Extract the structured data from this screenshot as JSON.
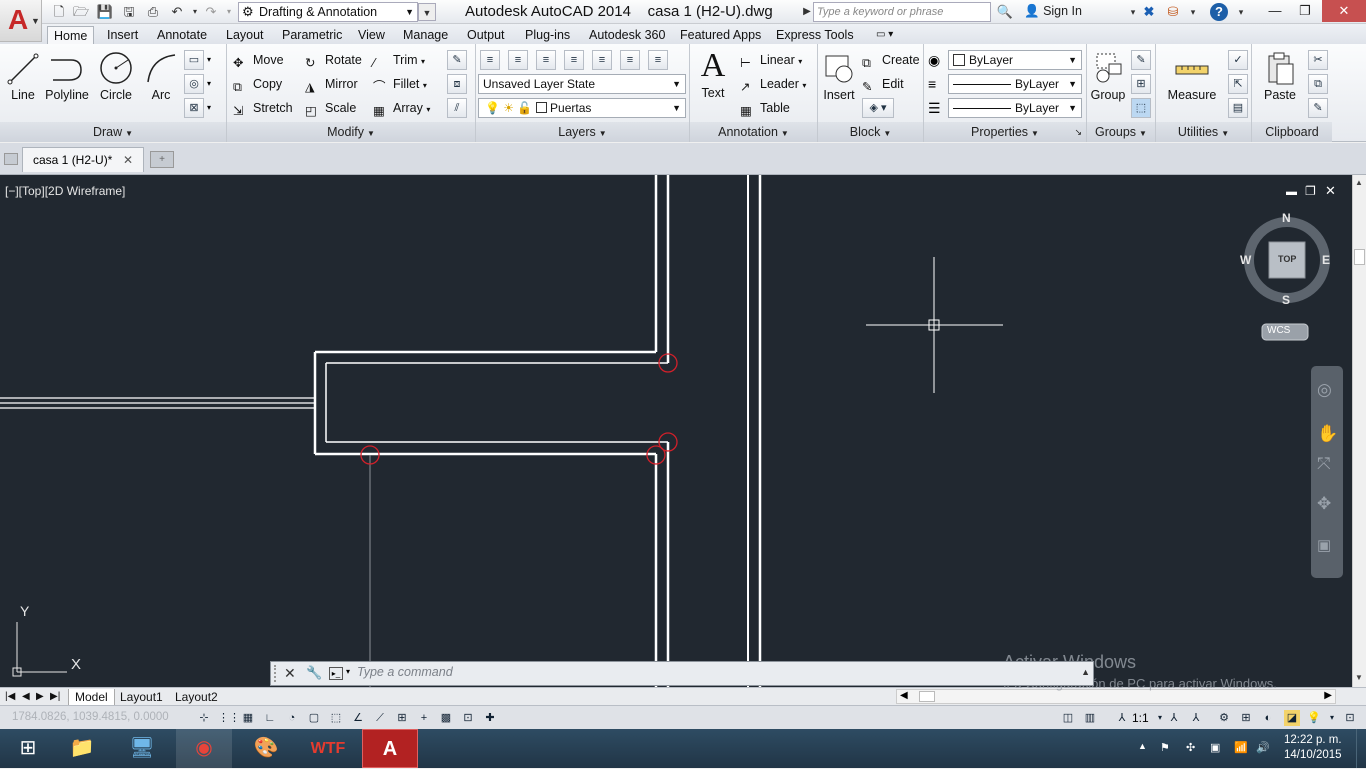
{
  "app": {
    "logo": "A",
    "workspace": "Drafting & Annotation",
    "window_title": "Autodesk AutoCAD 2014",
    "document_name": "casa 1 (H2-U).dwg",
    "search_placeholder": "Type a keyword or phrase",
    "sign_in": "Sign In"
  },
  "ribbon_tabs": [
    "Home",
    "Insert",
    "Annotate",
    "Layout",
    "Parametric",
    "View",
    "Manage",
    "Output",
    "Plug-ins",
    "Autodesk 360",
    "Featured Apps",
    "Express Tools"
  ],
  "panels": {
    "draw": {
      "title": "Draw",
      "line": "Line",
      "polyline": "Polyline",
      "circle": "Circle",
      "arc": "Arc"
    },
    "modify": {
      "title": "Modify",
      "move": "Move",
      "rotate": "Rotate",
      "trim": "Trim",
      "copy": "Copy",
      "mirror": "Mirror",
      "fillet": "Fillet",
      "stretch": "Stretch",
      "scale": "Scale",
      "array": "Array"
    },
    "layers": {
      "title": "Layers",
      "layer_state": "Unsaved Layer State",
      "current_layer": "Puertas"
    },
    "annotation": {
      "title": "Annotation",
      "text": "Text",
      "linear": "Linear",
      "leader": "Leader",
      "table": "Table"
    },
    "block": {
      "title": "Block",
      "insert": "Insert",
      "create": "Create",
      "edit": "Edit"
    },
    "properties": {
      "title": "Properties",
      "color": "ByLayer",
      "linetype": "ByLayer",
      "lineweight": "ByLayer"
    },
    "groups": {
      "title": "Groups",
      "group": "Group"
    },
    "utilities": {
      "title": "Utilities",
      "measure": "Measure"
    },
    "clipboard": {
      "title": "Clipboard",
      "paste": "Paste"
    }
  },
  "doc_tab": "casa 1 (H2-U)*",
  "viewport": {
    "label": "[−][Top][2D Wireframe]",
    "viewcube": {
      "north": "N",
      "south": "S",
      "east": "E",
      "west": "W",
      "face": "TOP",
      "wcs": "WCS"
    },
    "ucs": {
      "x": "X",
      "y": "Y"
    }
  },
  "command_placeholder": "Type a command",
  "layout_tabs": [
    "Model",
    "Layout1",
    "Layout2"
  ],
  "status": {
    "coords": "1784.0826, 1039.4815, 0.0000",
    "scale": "1:1"
  },
  "watermark": {
    "title": "Activar Windows",
    "subtitle": "Ir a Configuración de PC para activar Windows."
  },
  "taskbar": {
    "time": "12:22 p. m.",
    "date": "14/10/2015",
    "wtf": "WTF"
  },
  "colors": {
    "viewport_bg": "#212830",
    "wall": "#ffffff",
    "marker": "#d0202a",
    "accent": "#c62828"
  }
}
